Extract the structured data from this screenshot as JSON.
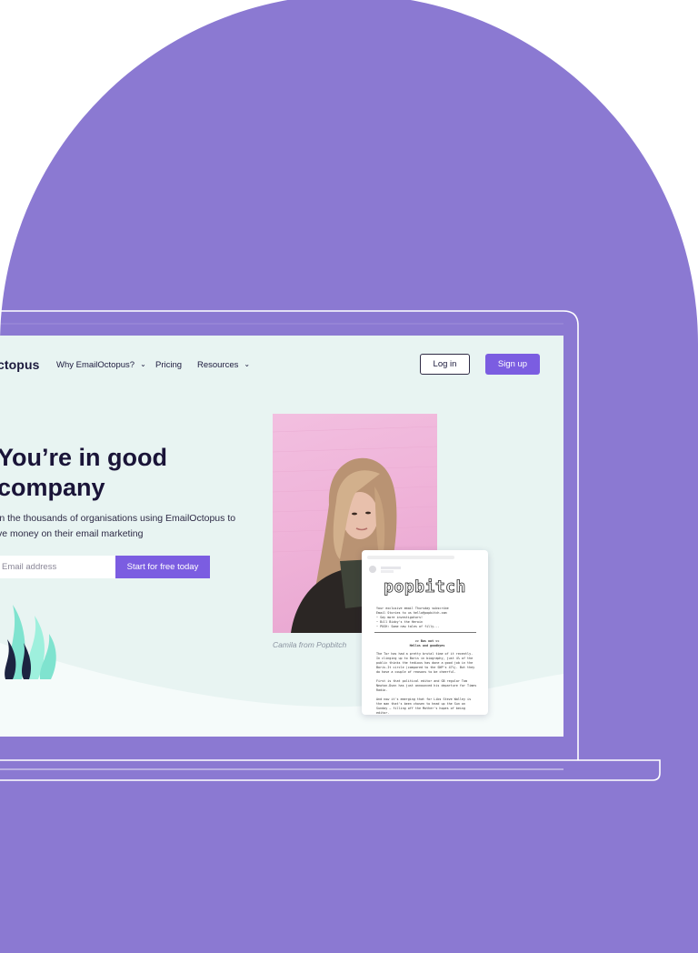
{
  "nav": {
    "logo": "ctopus",
    "items": [
      {
        "label": "Why EmailOctopus?",
        "has_chevron": true,
        "chevron": "⌄"
      },
      {
        "label": "Pricing",
        "has_chevron": false
      },
      {
        "label": "Resources",
        "has_chevron": true,
        "chevron": "⌄"
      }
    ],
    "login_label": "Log in",
    "signup_label": "Sign up"
  },
  "hero": {
    "title_line1": "You’re in good",
    "title_line2": "company",
    "subtitle_line1": "in the thousands of organisations using EmailOctopus to",
    "subtitle_line2": "ve money on their email marketing",
    "email_placeholder": "Email address",
    "cta_label": "Start for free today"
  },
  "testimonial": {
    "caption": "Camila from Popbitch"
  },
  "email_preview": {
    "brand": "popbitch",
    "intro": "Your exclusive email Thursday subscribe\nEmail Stories to us hello@popbitch.com\n~ Say more investigators!\n~ Bill Bixby's the Heroin\n~ PUSH: Some new tales of filly...",
    "section_heading": ">> Bus out <<\nHellos and goodbyes",
    "body": "The Tor has had a pretty brutal time of it recently. In clinging up to Boris in biography, just 4% of the public thinks the tedious has done a good job in the Boris.It circle (compared to the SNP's 47%). But they do have a couple of reasons to be cheerful.\n\nFirst is that political editor and GB regular Tom Newton-Dunn has just announced his departure for Times Radio.\n\nAnd now it's emerging that for Libs Steve Walley is the man that's been chosen to head up the Sun on Sunday — filling off the Mother's hopes of being editor."
  },
  "colors": {
    "background": "#8b79d2",
    "accent": "#7b5de1",
    "screen_bg": "#e8f4f2",
    "heading": "#1a1438"
  }
}
